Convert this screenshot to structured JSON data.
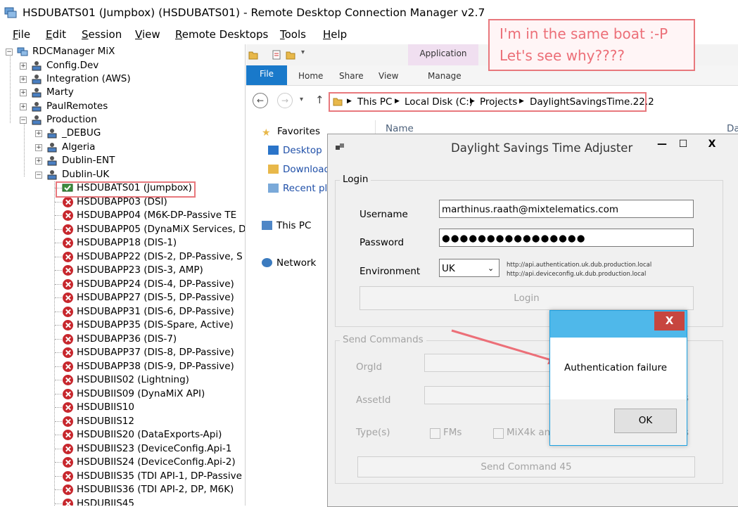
{
  "window": {
    "title": "HSDUBATS01 (Jumpbox) (HSDUBATS01) - Remote Desktop Connection Manager v2.7"
  },
  "menu": [
    "File",
    "Edit",
    "Session",
    "View",
    "Remote Desktops",
    "Tools",
    "Help"
  ],
  "annotation": {
    "line1": "I'm in the same boat :-P",
    "line2": "Let's see why????",
    "color": "#ec6f78"
  },
  "tree": {
    "root": "RDCManager MiX",
    "top_groups": [
      "Config.Dev",
      "Integration (AWS)",
      "Marty",
      "PaulRemotes",
      "Production"
    ],
    "production_groups": [
      "_DEBUG",
      "Algeria",
      "Dublin-ENT",
      "Dublin-UK"
    ],
    "servers": [
      "HSDUBATS01 (Jumpbox)",
      "HSDUBAPP03 (DSI)",
      "HSDUBAPP04 (M6K-DP-Passive TE",
      "HSDUBAPP05 (DynaMiX Services, D",
      "HSDUBAPP18 (DIS-1)",
      "HSDUBAPP22 (DIS-2, DP-Passive, S",
      "HSDUBAPP23 (DIS-3, AMP)",
      "HSDUBAPP24 (DIS-4, DP-Passive)",
      "HSDUBAPP27 (DIS-5, DP-Passive)",
      "HSDUBAPP31 (DIS-6, DP-Passive)",
      "HSDUBAPP35 (DIS-Spare, Active)",
      "HSDUBAPP36 (DIS-7)",
      "HSDUBAPP37 (DIS-8, DP-Passive)",
      "HSDUBAPP38 (DIS-9, DP-Passive)",
      "HSDUBIIS02 (Lightning)",
      "HSDUBIIS09 (DynaMiX API)",
      "HSDUBIIS10",
      "HSDUBIIS12",
      "HSDUBIIS20 (DataExports-Api)",
      "HSDUBIIS23 (DeviceConfig.Api-1",
      "HSDUBIIS24 (DeviceConfig.Api-2)",
      "HSDUBIIS35 (TDI API-1, DP-Passive",
      "HSDUBIIS36 (TDI API-2, DP, M6K)",
      "HSDUBIIS45"
    ]
  },
  "explorer": {
    "app_tools": "Application Tools",
    "tabs": {
      "file": "File",
      "home": "Home",
      "share": "Share",
      "view": "View",
      "manage": "Manage"
    },
    "breadcrumb": [
      "This PC",
      "Local Disk (C:)",
      "Projects",
      "DaylightSavingsTime.22.2"
    ],
    "column_name": "Name",
    "column_date": "Da",
    "nav": {
      "favorites": "Favorites",
      "desktop": "Desktop",
      "downloads": "Download",
      "recent": "Recent pla",
      "thispc": "This PC",
      "network": "Network"
    }
  },
  "dst": {
    "title": "Daylight Savings Time Adjuster",
    "login_group": "Login",
    "username_label": "Username",
    "username_value": "marthinus.raath@mixtelematics.com",
    "password_label": "Password",
    "password_value": "●●●●●●●●●●●●●●●●",
    "environment_label": "Environment",
    "environment_value": "UK",
    "env_url1": "http://api.authentication.uk.dub.production.local",
    "env_url2": "http://api.deviceconfig.uk.dub.production.local",
    "login_button": "Login",
    "send_group": "Send Commands",
    "orgid_label": "OrgId",
    "assetid_label": "AssetId",
    "types_label": "Type(s)",
    "fms_label": "FMs",
    "mix4k_label": "MiX4k and",
    "s_fragment": "s",
    "send_button": "Send Command 45"
  },
  "msgbox": {
    "message": "Authentication failure",
    "ok_label": "OK",
    "close_label": "X"
  }
}
